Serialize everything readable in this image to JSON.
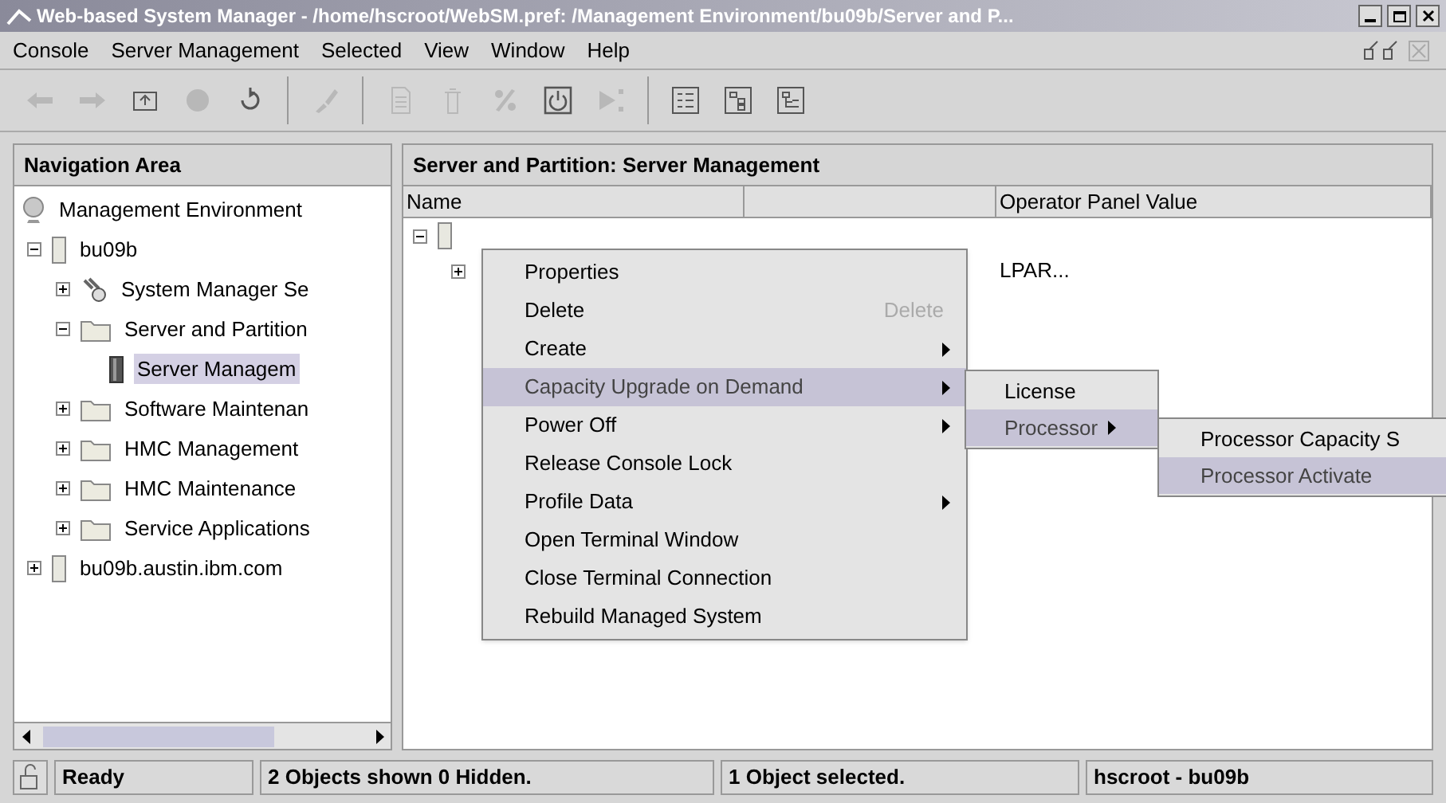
{
  "window": {
    "title": "Web-based System Manager - /home/hscroot/WebSM.pref: /Management Environment/bu09b/Server and P..."
  },
  "menu_bar": [
    "Console",
    "Server Management",
    "Selected",
    "View",
    "Window",
    "Help"
  ],
  "toolbar": [
    {
      "kind": "back",
      "disabled": true
    },
    {
      "kind": "forward",
      "disabled": true
    },
    {
      "kind": "up",
      "disabled": false
    },
    {
      "kind": "stop",
      "disabled": true
    },
    {
      "kind": "reload",
      "disabled": false
    },
    {
      "kind": "sep"
    },
    {
      "kind": "brush",
      "disabled": true
    },
    {
      "kind": "sep"
    },
    {
      "kind": "doc",
      "disabled": true
    },
    {
      "kind": "trash",
      "disabled": true
    },
    {
      "kind": "percent",
      "disabled": true
    },
    {
      "kind": "power",
      "disabled": false
    },
    {
      "kind": "play",
      "disabled": true
    },
    {
      "kind": "sep"
    },
    {
      "kind": "list",
      "disabled": false
    },
    {
      "kind": "tree",
      "disabled": false
    },
    {
      "kind": "details",
      "disabled": false
    }
  ],
  "navigation": {
    "title": "Navigation Area",
    "tree": [
      {
        "label": "Management Environment",
        "kind": "globe",
        "selected": false,
        "children": [
          {
            "label": "bu09b",
            "kind": "server",
            "expanded": true,
            "selected": false,
            "children": [
              {
                "label": "System Manager Se",
                "kind": "tools",
                "expanded": false,
                "selected": false
              },
              {
                "label": "Server and Partition",
                "kind": "folder",
                "expanded": true,
                "selected": false,
                "children": [
                  {
                    "label": "Server Managem",
                    "kind": "rack",
                    "selected": true
                  }
                ]
              },
              {
                "label": "Software Maintenan",
                "kind": "folder",
                "expanded": false,
                "selected": false
              },
              {
                "label": "HMC Management",
                "kind": "folder",
                "expanded": false,
                "selected": false
              },
              {
                "label": "HMC Maintenance",
                "kind": "folder",
                "expanded": false,
                "selected": false
              },
              {
                "label": "Service Applications",
                "kind": "folder",
                "expanded": false,
                "selected": false
              }
            ]
          },
          {
            "label": "bu09b.austin.ibm.com",
            "kind": "server",
            "expanded": false,
            "selected": false
          }
        ]
      }
    ]
  },
  "content": {
    "title": "Server and Partition: Server Management",
    "columns": [
      "Name",
      "",
      "Operator Panel Value"
    ],
    "rows": [
      {
        "expanded": true,
        "operator_value": ""
      },
      {
        "expanded": false,
        "operator_value": "LPAR..."
      }
    ]
  },
  "context_menu": [
    {
      "label": "Properties",
      "submenu": false,
      "selected": false
    },
    {
      "label": "Delete",
      "shortcut": "Delete",
      "submenu": false,
      "selected": false
    },
    {
      "label": "Create",
      "submenu": true,
      "selected": false
    },
    {
      "label": "Capacity Upgrade on Demand",
      "submenu": true,
      "selected": true
    },
    {
      "label": "Power Off",
      "submenu": true,
      "selected": false
    },
    {
      "label": "Release Console Lock",
      "submenu": false,
      "selected": false
    },
    {
      "label": "Profile Data",
      "submenu": true,
      "selected": false
    },
    {
      "label": "Open Terminal Window",
      "submenu": false,
      "selected": false
    },
    {
      "label": "Close Terminal Connection",
      "submenu": false,
      "selected": false
    },
    {
      "label": "Rebuild Managed System",
      "submenu": false,
      "selected": false
    }
  ],
  "submenu": [
    {
      "label": "License",
      "submenu": false,
      "selected": false
    },
    {
      "label": "Processor",
      "submenu": true,
      "selected": true
    }
  ],
  "submenu_2": [
    {
      "label": "Processor Capacity S",
      "selected": false
    },
    {
      "label": "Processor Activate",
      "selected": true
    }
  ],
  "status_bar": [
    "Ready",
    "2 Objects shown 0 Hidden.",
    "1 Object selected.",
    "hscroot - bu09b"
  ]
}
